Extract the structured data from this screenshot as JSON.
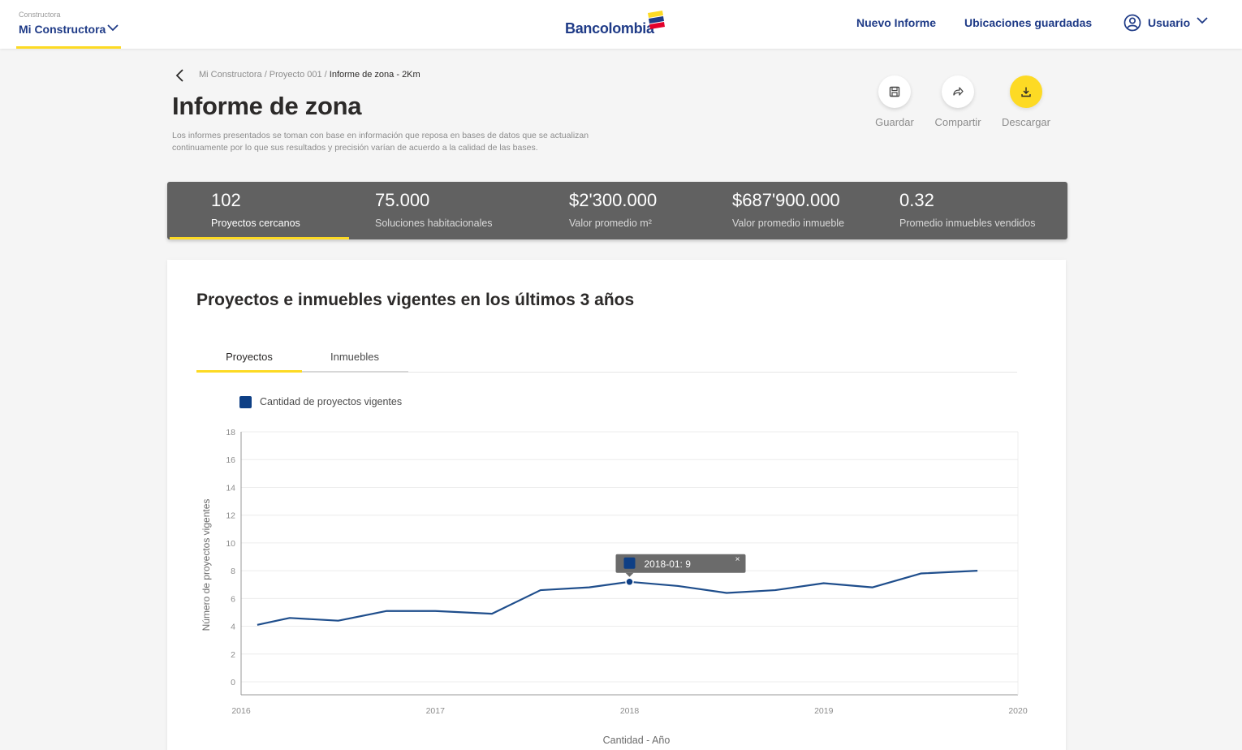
{
  "topbar": {
    "company_label": "Constructora",
    "company_name": "Mi Constructora",
    "logo_text": "Bancolombia",
    "nav": [
      "Nuevo Informe",
      "Ubicaciones guardadas"
    ],
    "user": "Usuario",
    "colors": {
      "brand_blue": "#1f3b87",
      "accent_yellow": "#fdda24"
    }
  },
  "breadcrumb": {
    "path": "Mi Constructora / Proyecto 001 /",
    "current": "Informe de zona - 2Km"
  },
  "page": {
    "title": "Informe de zona",
    "disclaimer": "Los informes presentados se toman con base en información que reposa en bases de datos que se actualizan continuamente por lo que sus resultados y precisión varían de acuerdo a la calidad de las bases."
  },
  "actions": {
    "save": "Guardar",
    "share": "Compartir",
    "download": "Descargar"
  },
  "stats": [
    {
      "value": "102",
      "caption": "Proyectos cercanos"
    },
    {
      "value": "75.000",
      "caption": "Soluciones habitacionales"
    },
    {
      "value": "$2'300.000",
      "caption": "Valor promedio m²"
    },
    {
      "value": "$687'900.000",
      "caption": "Valor promedio inmueble"
    },
    {
      "value": "0.32",
      "caption": "Promedio inmuebles vendidos"
    }
  ],
  "card": {
    "title": "Proyectos e inmuebles vigentes en los últimos 3 años",
    "tabs": [
      "Proyectos",
      "Inmuebles"
    ],
    "legend": "Cantidad de proyectos vigentes"
  },
  "chart_data": {
    "type": "line",
    "xlabel": "Cantidad - Año",
    "ylabel": "Número de proyectos vigentes",
    "xlim": [
      2016,
      2020
    ],
    "ylim": [
      0,
      18
    ],
    "x_ticks": [
      "2016",
      "2017",
      "2018",
      "2019",
      "2020"
    ],
    "y_ticks": [
      "0",
      "2",
      "4",
      "6",
      "8",
      "10",
      "12",
      "14",
      "16",
      "18"
    ],
    "grid": true,
    "series": [
      {
        "name": "Cantidad de proyectos vigentes",
        "color": "#1f4e8c",
        "x": [
          2016.0833,
          2016.25,
          2016.5,
          2016.75,
          2017.0,
          2017.2917,
          2017.5417,
          2017.7917,
          2018.0,
          2018.25,
          2018.5,
          2018.75,
          2019.0,
          2019.25,
          2019.5,
          2019.7917
        ],
        "y": [
          4.1,
          4.6,
          4.4,
          5.1,
          5.1,
          4.9,
          6.6,
          6.8,
          7.2,
          6.9,
          6.4,
          6.6,
          7.1,
          6.8,
          7.8,
          8.0
        ]
      }
    ],
    "tooltip": {
      "label": "2018-01: 9",
      "x": 2018.0,
      "y": 7.2
    }
  }
}
